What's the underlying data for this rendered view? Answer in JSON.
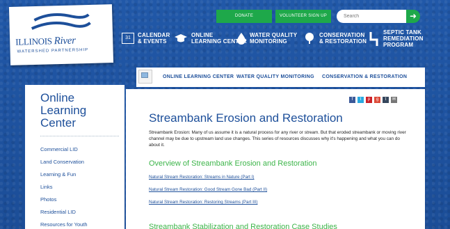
{
  "logo": {
    "line1": "ILLINOIS",
    "line1_river": "River",
    "line2": "WATERSHED PARTNERSHIP"
  },
  "top": {
    "donate": "DONATE",
    "volunteer": "VOLUNTEER SIGN UP",
    "search_placeholder": "Search",
    "search_go": "➜"
  },
  "nav": [
    {
      "label": "CALENDAR\n& EVENTS",
      "icon": "calendar-icon",
      "icon_text": "31"
    },
    {
      "label": "ONLINE\nLEARNING CENTER",
      "icon": "graduation-cap-icon"
    },
    {
      "label": "WATER QUALITY\nMONITORING",
      "icon": "water-drop-icon"
    },
    {
      "label": "CONSERVATION\n& RESTORATION",
      "icon": "tree-icon"
    },
    {
      "label": "SEPTIC TANK\nREMEDIATION\nPROGRAM",
      "icon": "pipe-icon"
    }
  ],
  "breadcrumb": [
    "ONLINE LEARNING CENTER",
    "WATER QUALITY MONITORING",
    "CONSERVATION & RESTORATION"
  ],
  "sidebar": {
    "title": "Online\nLearning\nCenter",
    "items": [
      "Commercial LID",
      "Land Conservation",
      "Learning & Fun",
      "Links",
      "Photos",
      "Residential LID",
      "Resources for Youth"
    ]
  },
  "share_icons": [
    {
      "name": "facebook-icon",
      "color": "#3b5998",
      "glyph": "f"
    },
    {
      "name": "twitter-icon",
      "color": "#29a9e1",
      "glyph": "t"
    },
    {
      "name": "pinterest-icon",
      "color": "#cb2027",
      "glyph": "p"
    },
    {
      "name": "googleplus-icon",
      "color": "#dd4b39",
      "glyph": "g"
    },
    {
      "name": "tumblr-icon",
      "color": "#35465c",
      "glyph": "t"
    },
    {
      "name": "email-icon",
      "color": "#777777",
      "glyph": "✉"
    }
  ],
  "main": {
    "title": "Streambank Erosion and Restoration",
    "intro": "Streambank Erosion: Many of us assume it is a natural process for any river or stream. But that eroded streambank or moving river channel may be due to upstream land use changes. This series of resources discusses why it's happening and what you can do about it.",
    "section1": "Overview of Streambank Erosion and Restoration",
    "links": [
      "Natural Stream Restoration: Streams in Nature (Part I)",
      "Natural Stream Restoration: Good Stream Gone Bad (Part II)",
      "Natural Stream Restoration: Restoring Streams (Part III)"
    ],
    "section2": "Streambank Stabilization and Restoration Case Studies"
  },
  "colors": {
    "brand_blue": "#1d4f9a",
    "accent_green": "#1ea84a",
    "heading_green": "#3db54a"
  }
}
